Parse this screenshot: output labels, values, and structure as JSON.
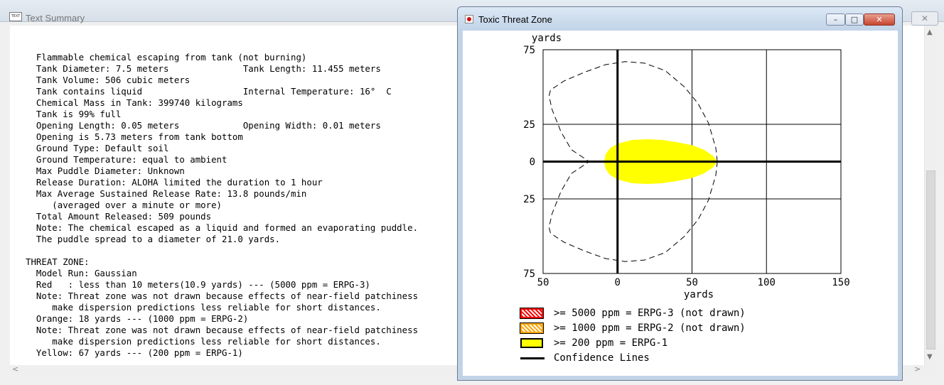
{
  "summary_window": {
    "title": "Text Summary",
    "icon_text": "TEXT",
    "lines": [
      "  Flammable chemical escaping from tank (not burning)",
      "  Tank Diameter: 7.5 meters              Tank Length: 11.455 meters",
      "  Tank Volume: 506 cubic meters",
      "  Tank contains liquid                   Internal Temperature: 16°  C",
      "  Chemical Mass in Tank: 399740 kilograms",
      "  Tank is 99% full",
      "  Opening Length: 0.05 meters            Opening Width: 0.01 meters",
      "  Opening is 5.73 meters from tank bottom",
      "  Ground Type: Default soil",
      "  Ground Temperature: equal to ambient",
      "  Max Puddle Diameter: Unknown",
      "  Release Duration: ALOHA limited the duration to 1 hour",
      "  Max Average Sustained Release Rate: 13.8 pounds/min",
      "     (averaged over a minute or more)",
      "  Total Amount Released: 509 pounds",
      "  Note: The chemical escaped as a liquid and formed an evaporating puddle.",
      "  The puddle spread to a diameter of 21.0 yards.",
      "",
      "THREAT ZONE:",
      "  Model Run: Gaussian",
      "  Red   : less than 10 meters(10.9 yards) --- (5000 ppm = ERPG-3)",
      "  Note: Threat zone was not drawn because effects of near-field patchiness",
      "     make dispersion predictions less reliable for short distances.",
      "  Orange: 18 yards --- (1000 ppm = ERPG-2)",
      "  Note: Threat zone was not drawn because effects of near-field patchiness",
      "     make dispersion predictions less reliable for short distances.",
      "  Yellow: 67 yards --- (200 ppm = ERPG-1)"
    ]
  },
  "threat_window": {
    "title": "Toxic Threat Zone",
    "controls": {
      "minimize": "–",
      "maximize": "□",
      "close": "✕"
    }
  },
  "chart_data": {
    "type": "area",
    "xlabel": "yards",
    "ylabel": "yards",
    "xlim": [
      -50,
      150
    ],
    "ylim": [
      -75,
      75
    ],
    "x_ticks": [
      -50,
      0,
      50,
      100,
      150
    ],
    "x_tick_labels": [
      "50",
      "0",
      "50",
      "100",
      "150"
    ],
    "y_ticks": [
      75,
      25,
      0,
      -25,
      -75
    ],
    "y_tick_labels": [
      "75",
      "25",
      "0",
      "25",
      "75"
    ],
    "grid": true,
    "yellow_zone": {
      "color": "#ffff00",
      "x_range": [
        -9,
        67
      ],
      "max_half_width": 15,
      "points": [
        [
          -9,
          0
        ],
        [
          -8,
          5
        ],
        [
          -5,
          9
        ],
        [
          0,
          12
        ],
        [
          10,
          14.5
        ],
        [
          20,
          15
        ],
        [
          30,
          14.5
        ],
        [
          40,
          13
        ],
        [
          50,
          11
        ],
        [
          58,
          8
        ],
        [
          64,
          4
        ],
        [
          67,
          0
        ],
        [
          64,
          -4
        ],
        [
          58,
          -8
        ],
        [
          50,
          -11
        ],
        [
          40,
          -13
        ],
        [
          30,
          -14.5
        ],
        [
          20,
          -15
        ],
        [
          10,
          -14.5
        ],
        [
          0,
          -12
        ],
        [
          -5,
          -9
        ],
        [
          -8,
          -5
        ]
      ]
    },
    "confidence_lines": {
      "style": "dashed",
      "points": [
        [
          67,
          0
        ],
        [
          66,
          9
        ],
        [
          61,
          26
        ],
        [
          54,
          39
        ],
        [
          45,
          50
        ],
        [
          32,
          61
        ],
        [
          18,
          66
        ],
        [
          5,
          67
        ],
        [
          -8,
          65
        ],
        [
          -22,
          60
        ],
        [
          -36,
          54
        ],
        [
          -45,
          48
        ],
        [
          -46,
          44
        ],
        [
          -44,
          35
        ],
        [
          -38,
          20
        ],
        [
          -31,
          8
        ],
        [
          -19,
          0
        ],
        [
          -31,
          -8
        ],
        [
          -38,
          -20
        ],
        [
          -44,
          -35
        ],
        [
          -46,
          -44
        ],
        [
          -45,
          -48
        ],
        [
          -36,
          -54
        ],
        [
          -22,
          -60
        ],
        [
          -8,
          -65
        ],
        [
          5,
          -67
        ],
        [
          18,
          -66
        ],
        [
          32,
          -61
        ],
        [
          45,
          -50
        ],
        [
          54,
          -39
        ],
        [
          61,
          -26
        ],
        [
          66,
          -9
        ],
        [
          67,
          0
        ]
      ]
    },
    "legend": [
      {
        "label": ">= 5000 ppm = ERPG-3 (not drawn)",
        "color": "#ff0000",
        "kind": "swatch"
      },
      {
        "label": ">= 1000 ppm = ERPG-2 (not drawn)",
        "color": "#ffa500",
        "kind": "swatch"
      },
      {
        "label": ">= 200 ppm = ERPG-1",
        "color": "#ffff00",
        "kind": "swatch"
      },
      {
        "label": "Confidence Lines",
        "color": "#000000",
        "kind": "line"
      }
    ]
  }
}
